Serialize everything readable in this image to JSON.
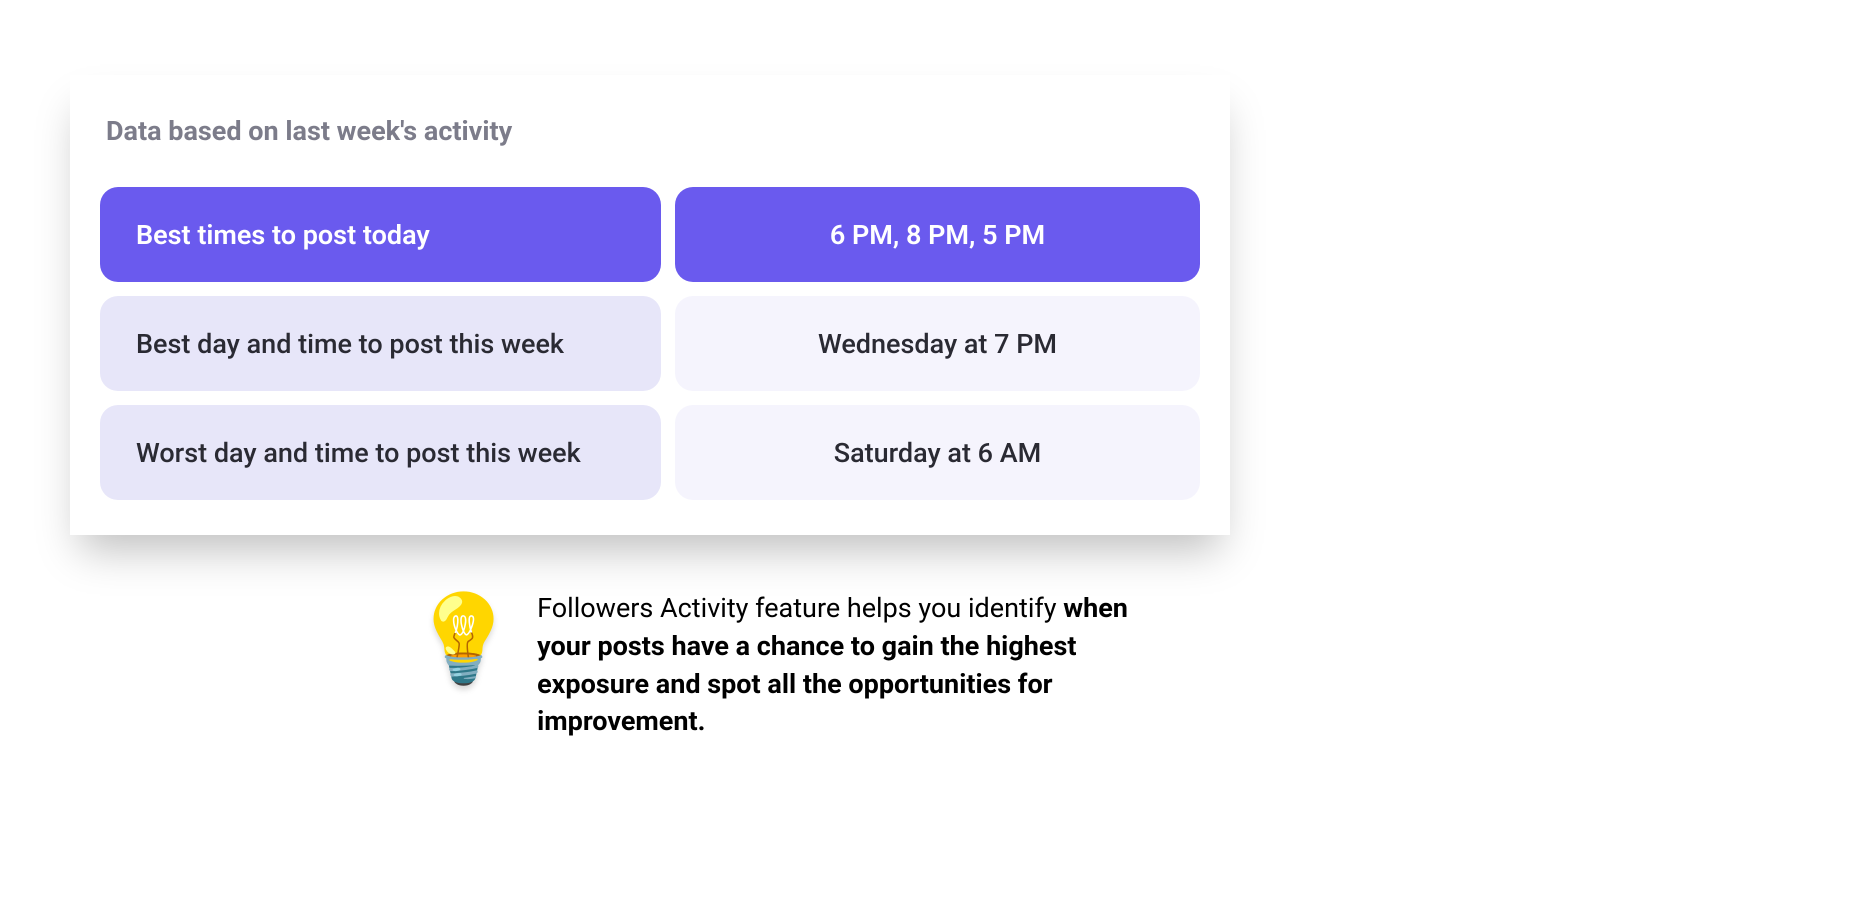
{
  "card": {
    "header": "Data based on last week's activity",
    "rows": [
      {
        "label": "Best times to post today",
        "value": "6 PM, 8 PM, 5 PM"
      },
      {
        "label": "Best day and time to post this week",
        "value": "Wednesday at 7 PM"
      },
      {
        "label": "Worst day and time to post this week",
        "value": "Saturday at 6 AM"
      }
    ]
  },
  "tip": {
    "prefix": "Followers Activity feature helps you identify ",
    "bold": "when your posts have a chance to gain the highest exposure and spot all the opportunities for improvement."
  }
}
